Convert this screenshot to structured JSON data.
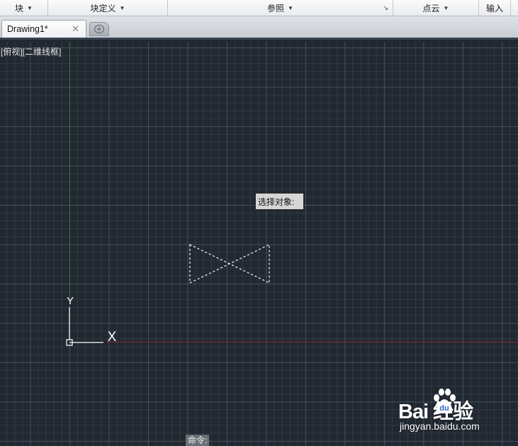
{
  "ribbon": {
    "panels": [
      {
        "label": "块",
        "has_arrow": true
      },
      {
        "label": "块定义",
        "has_arrow": true
      },
      {
        "label": "参照",
        "has_arrow": true
      },
      {
        "label": "点云",
        "has_arrow": true
      },
      {
        "label": "输入",
        "has_arrow": false
      }
    ]
  },
  "tabs": {
    "document_tab": "Drawing1*",
    "close_glyph": "✕"
  },
  "viewport": {
    "label": "[俯视][二维线框]"
  },
  "ucs": {
    "y_label": "Y",
    "x_label": "X"
  },
  "tooltip": {
    "text": "选择对象:"
  },
  "command": {
    "prompt": "命令:"
  },
  "watermark": {
    "brand": "Bai  经验",
    "url": "jingyan.baidu.com"
  },
  "colors": {
    "canvas_bg": "#212830",
    "y_axis": "#2f7d33",
    "x_axis": "#8a2b33",
    "selection_dash": "#ffffff"
  }
}
